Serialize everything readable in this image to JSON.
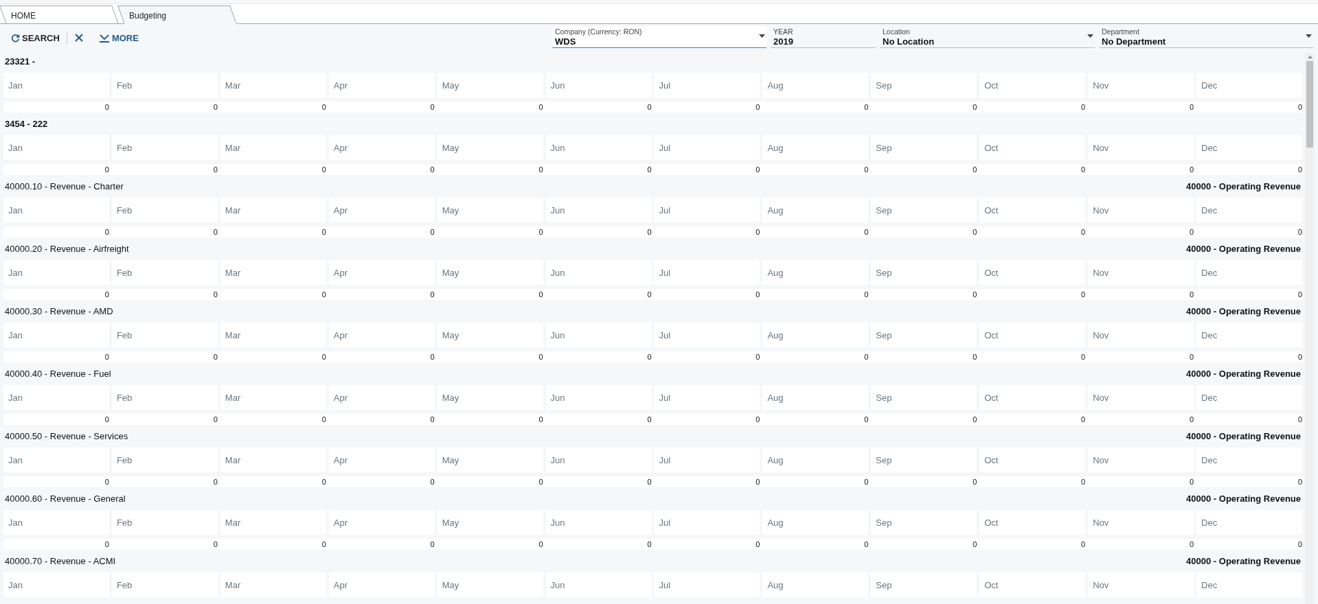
{
  "tabs": [
    {
      "label": "HOME",
      "selected": false
    },
    {
      "label": "Budgeting",
      "selected": true
    }
  ],
  "toolbar": {
    "search": "SEARCH",
    "more": "MORE"
  },
  "filters": [
    {
      "label": "Company (Currency: RON)",
      "value": "WDS",
      "kind": "dropdown",
      "focused": true
    },
    {
      "label": "YEAR",
      "value": "2019",
      "kind": "text",
      "focused": false
    },
    {
      "label": "Location",
      "value": "No Location",
      "kind": "dropdown",
      "focused": false
    },
    {
      "label": "Department",
      "value": "No Department",
      "kind": "dropdown",
      "focused": false
    }
  ],
  "accounts": [
    {
      "title": "23321 -",
      "bold": true,
      "months": [
        {
          "placeholder": "Jan"
        },
        {
          "placeholder": "Feb"
        },
        {
          "placeholder": "Mar"
        },
        {
          "placeholder": "Apr"
        },
        {
          "placeholder": "May"
        },
        {
          "placeholder": "Jun"
        },
        {
          "placeholder": "Jul"
        },
        {
          "placeholder": "Aug"
        },
        {
          "placeholder": "Sep"
        },
        {
          "placeholder": "Oct"
        },
        {
          "placeholder": "Nov"
        },
        {
          "placeholder": "Dec"
        }
      ],
      "totals": [
        "0",
        "0",
        "0",
        "0",
        "0",
        "0",
        "0",
        "0",
        "0",
        "0",
        "0",
        "0"
      ]
    },
    {
      "title": "3454 - 222",
      "bold": true,
      "months": [
        {
          "placeholder": "Jan"
        },
        {
          "placeholder": "Feb"
        },
        {
          "placeholder": "Mar"
        },
        {
          "placeholder": "Apr"
        },
        {
          "placeholder": "May"
        },
        {
          "placeholder": "Jun"
        },
        {
          "placeholder": "Jul"
        },
        {
          "placeholder": "Aug"
        },
        {
          "placeholder": "Sep"
        },
        {
          "placeholder": "Oct"
        },
        {
          "placeholder": "Nov"
        },
        {
          "placeholder": "Dec"
        }
      ],
      "totals": [
        "0",
        "0",
        "0",
        "0",
        "0",
        "0",
        "0",
        "0",
        "0",
        "0",
        "0",
        "0"
      ]
    },
    {
      "title": "40000.10 - Revenue - Charter",
      "bold": false,
      "group": "40000 - Operating Revenue",
      "months": [
        {
          "placeholder": "Jan"
        },
        {
          "placeholder": "Feb"
        },
        {
          "placeholder": "Mar"
        },
        {
          "placeholder": "Apr"
        },
        {
          "placeholder": "May"
        },
        {
          "placeholder": "Jun"
        },
        {
          "placeholder": "Jul"
        },
        {
          "placeholder": "Aug"
        },
        {
          "placeholder": "Sep"
        },
        {
          "placeholder": "Oct"
        },
        {
          "placeholder": "Nov"
        },
        {
          "placeholder": "Dec"
        }
      ],
      "totals": [
        "0",
        "0",
        "0",
        "0",
        "0",
        "0",
        "0",
        "0",
        "0",
        "0",
        "0",
        "0"
      ]
    },
    {
      "title": "40000.20 - Revenue - Airfreight",
      "bold": false,
      "group": "40000 - Operating Revenue",
      "months": [
        {
          "placeholder": "Jan"
        },
        {
          "placeholder": "Feb"
        },
        {
          "placeholder": "Mar"
        },
        {
          "placeholder": "Apr"
        },
        {
          "placeholder": "May"
        },
        {
          "placeholder": "Jun"
        },
        {
          "placeholder": "Jul"
        },
        {
          "placeholder": "Aug"
        },
        {
          "placeholder": "Sep"
        },
        {
          "placeholder": "Oct"
        },
        {
          "placeholder": "Nov"
        },
        {
          "placeholder": "Dec"
        }
      ],
      "totals": [
        "0",
        "0",
        "0",
        "0",
        "0",
        "0",
        "0",
        "0",
        "0",
        "0",
        "0",
        "0"
      ]
    },
    {
      "title": "40000.30 - Revenue - AMD",
      "bold": false,
      "group": "40000 - Operating Revenue",
      "months": [
        {
          "placeholder": "Jan"
        },
        {
          "placeholder": "Feb"
        },
        {
          "placeholder": "Mar"
        },
        {
          "placeholder": "Apr"
        },
        {
          "placeholder": "May"
        },
        {
          "placeholder": "Jun"
        },
        {
          "placeholder": "Jul"
        },
        {
          "placeholder": "Aug"
        },
        {
          "placeholder": "Sep"
        },
        {
          "placeholder": "Oct"
        },
        {
          "placeholder": "Nov"
        },
        {
          "placeholder": "Dec"
        }
      ],
      "totals": [
        "0",
        "0",
        "0",
        "0",
        "0",
        "0",
        "0",
        "0",
        "0",
        "0",
        "0",
        "0"
      ]
    },
    {
      "title": "40000.40 - Revenue - Fuel",
      "bold": false,
      "group": "40000 - Operating Revenue",
      "months": [
        {
          "placeholder": "Jan"
        },
        {
          "placeholder": "Feb"
        },
        {
          "placeholder": "Mar"
        },
        {
          "placeholder": "Apr"
        },
        {
          "placeholder": "May"
        },
        {
          "placeholder": "Jun"
        },
        {
          "placeholder": "Jul"
        },
        {
          "placeholder": "Aug"
        },
        {
          "placeholder": "Sep"
        },
        {
          "placeholder": "Oct"
        },
        {
          "placeholder": "Nov"
        },
        {
          "placeholder": "Dec"
        }
      ],
      "totals": [
        "0",
        "0",
        "0",
        "0",
        "0",
        "0",
        "0",
        "0",
        "0",
        "0",
        "0",
        "0"
      ]
    },
    {
      "title": "40000.50 - Revenue - Services",
      "bold": false,
      "group": "40000 - Operating Revenue",
      "months": [
        {
          "placeholder": "Jan"
        },
        {
          "placeholder": "Feb"
        },
        {
          "placeholder": "Mar"
        },
        {
          "placeholder": "Apr"
        },
        {
          "placeholder": "May"
        },
        {
          "placeholder": "Jun"
        },
        {
          "placeholder": "Jul"
        },
        {
          "placeholder": "Aug"
        },
        {
          "placeholder": "Sep"
        },
        {
          "placeholder": "Oct"
        },
        {
          "placeholder": "Nov"
        },
        {
          "placeholder": "Dec"
        }
      ],
      "totals": [
        "0",
        "0",
        "0",
        "0",
        "0",
        "0",
        "0",
        "0",
        "0",
        "0",
        "0",
        "0"
      ]
    },
    {
      "title": "40000.60 - Revenue - General",
      "bold": false,
      "group": "40000 - Operating Revenue",
      "months": [
        {
          "placeholder": "Jan"
        },
        {
          "placeholder": "Feb"
        },
        {
          "placeholder": "Mar"
        },
        {
          "placeholder": "Apr"
        },
        {
          "placeholder": "May"
        },
        {
          "placeholder": "Jun"
        },
        {
          "placeholder": "Jul"
        },
        {
          "placeholder": "Aug"
        },
        {
          "placeholder": "Sep"
        },
        {
          "placeholder": "Oct"
        },
        {
          "placeholder": "Nov"
        },
        {
          "placeholder": "Dec"
        }
      ],
      "totals": [
        "0",
        "0",
        "0",
        "0",
        "0",
        "0",
        "0",
        "0",
        "0",
        "0",
        "0",
        "0"
      ]
    },
    {
      "title": "40000.70 - Revenue - ACMI",
      "bold": false,
      "group": "40000 - Operating Revenue",
      "months": [
        {
          "placeholder": "Jan"
        },
        {
          "placeholder": "Feb"
        },
        {
          "placeholder": "Mar"
        },
        {
          "placeholder": "Apr"
        },
        {
          "placeholder": "May"
        },
        {
          "placeholder": "Jun"
        },
        {
          "placeholder": "Jul"
        },
        {
          "placeholder": "Aug"
        },
        {
          "placeholder": "Sep"
        },
        {
          "placeholder": "Oct"
        },
        {
          "placeholder": "Nov"
        },
        {
          "placeholder": "Dec"
        }
      ]
    }
  ]
}
